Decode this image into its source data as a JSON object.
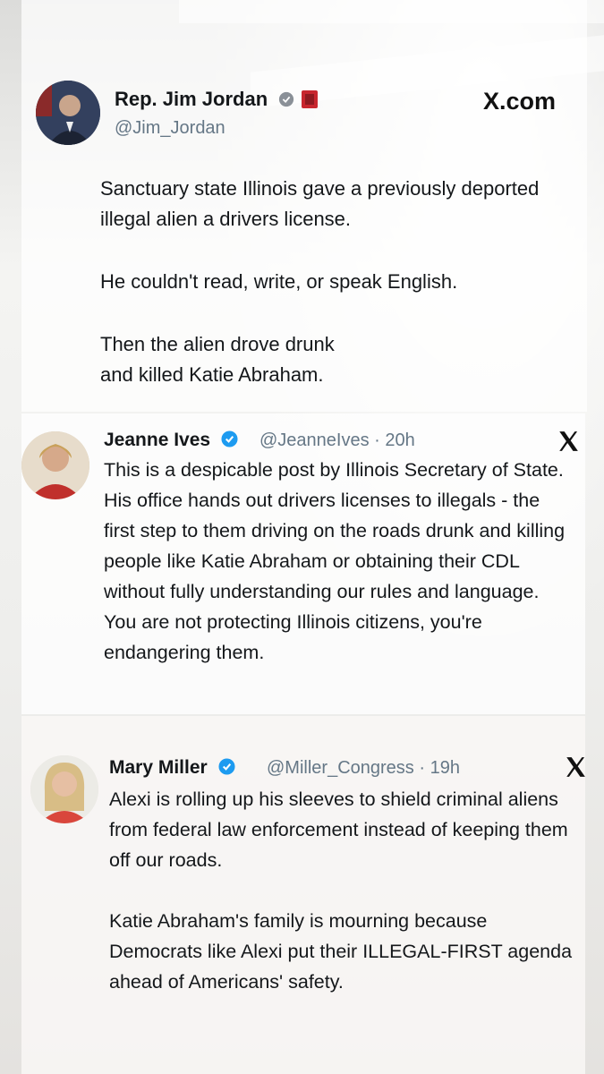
{
  "main_post": {
    "author_name": "Rep. Jim Jordan",
    "handle": "@Jim_Jordan",
    "site_label": "X.com",
    "paragraph_1": "Sanctuary state Illinois gave a previously deported illegal alien a drivers license.",
    "paragraph_2": "He couldn't read, write, or speak English.",
    "paragraph_3": "Then the alien drove drunk and killed Katie Abraham."
  },
  "reply_1": {
    "author_name": "Jeanne Ives",
    "handle_time": "@JeanneIves · 20h",
    "text": "This is a despicable post by Illinois Secretary of State. His office hands out drivers licenses to illegals - the first step to them driving on the roads drunk and killing people like Katie Abraham or obtaining their CDL without fully understanding our rules and language.  You are not protecting Illinois citizens, you're endangering them."
  },
  "reply_2": {
    "author_name": "Mary Miller",
    "handle_time": "@Miller_Congress · 19h",
    "paragraph_1": "Alexi is rolling up his sleeves to shield criminal aliens from federal law enforcement instead of keeping them off our roads.",
    "paragraph_2": "Katie Abraham's family is mourning because Democrats like Alexi put their ILLEGAL-FIRST agenda ahead of Americans' safety."
  },
  "icons": {
    "verified": "verified-badge-icon",
    "x_logo": "x-logo-icon",
    "flag": "congress-flag-icon"
  },
  "colors": {
    "verified_blue": "#1d9bf0",
    "text": "#14171a",
    "secondary": "#657786"
  }
}
